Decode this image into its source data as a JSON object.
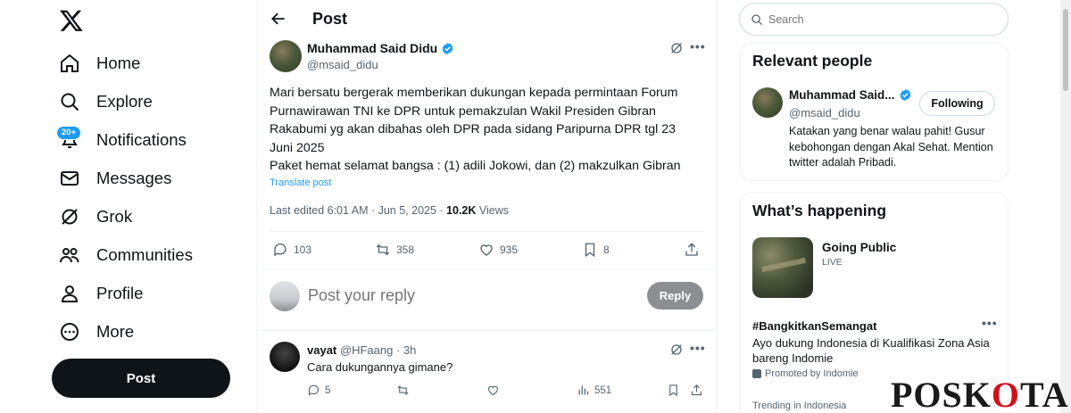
{
  "nav": {
    "items": [
      {
        "label": "Home",
        "icon": "home-icon"
      },
      {
        "label": "Explore",
        "icon": "search-icon"
      },
      {
        "label": "Notifications",
        "icon": "bell-icon"
      },
      {
        "label": "Messages",
        "icon": "mail-icon"
      },
      {
        "label": "Grok",
        "icon": "grok-icon"
      },
      {
        "label": "Communities",
        "icon": "people-icon"
      },
      {
        "label": "Profile",
        "icon": "person-icon"
      },
      {
        "label": "More",
        "icon": "more-circle-icon"
      }
    ],
    "notif_badge": "20+",
    "post_label": "Post"
  },
  "header": {
    "title": "Post"
  },
  "post": {
    "author_name": "Muhammad Said Didu",
    "author_handle": "@msaid_didu",
    "text_line1": "Mari bersatu bergerak memberikan dukungan kepada permintaan Forum Purnawirawan TNI ke DPR untuk pemakzulan Wakil Presiden Gibran Rakabumi yg akan dibahas oleh DPR pada sidang Paripurna DPR tgl 23 Juni 2025",
    "text_line2": "Paket hemat selamat bangsa : (1) adili Jokowi, dan (2) makzulkan Gibran",
    "translate": "Translate post",
    "edited": "Last edited 6:01 AM · Jun 5, 2025 · ",
    "views_count": "10.2K",
    "views_label": " Views",
    "replies": "103",
    "reposts": "358",
    "likes": "935",
    "bookmarks": "8"
  },
  "reply_box": {
    "placeholder": "Post your reply",
    "button": "Reply"
  },
  "reply": {
    "name": "vayat",
    "meta": "@HFaang · 3h",
    "text": "Cara dukungannya gimane?",
    "replies": "5",
    "views": "551"
  },
  "right": {
    "search_placeholder": "Search",
    "relevant_title": "Relevant people",
    "rp_name": "Muhammad Said...",
    "rp_handle": "@msaid_didu",
    "follow_label": "Following",
    "rp_bio": "Katakan yang benar walau pahit! Gusur kebohongan dengan Akal Sehat. Mention twitter adalah Pribadi.",
    "happening_title": "What’s happening",
    "trend_title": "Going Public",
    "trend_live": "LIVE",
    "hashtag": "#BangkitkanSemangat",
    "hashtag_desc": "Ayo dukung Indonesia di Kualifikasi Zona Asia bareng Indomie",
    "promoted": "Promoted by Indomie",
    "trending": "Trending in Indonesia"
  },
  "watermark": {
    "text_a": "POSK",
    "text_b": "O",
    "text_c": "TA"
  },
  "colors": {
    "accent": "#1d9bf0",
    "text": "#0f1419",
    "muted": "#536471",
    "watermark_red": "#d0111b"
  }
}
